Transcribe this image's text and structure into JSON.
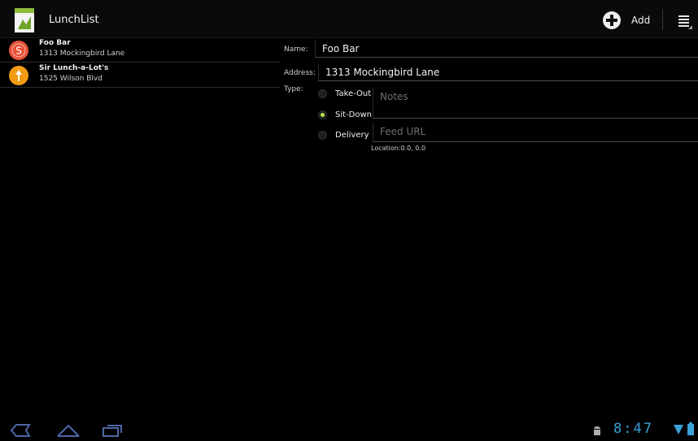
{
  "app": {
    "title": "LunchList"
  },
  "actionbar": {
    "add_label": "Add",
    "add_icon": "plus-circle-icon",
    "menu_icon": "overflow-menu-icon"
  },
  "restaurants": [
    {
      "name": "Foo Bar",
      "address": "1313 Mockingbird Lane",
      "icon": "sit-down-restaurant-icon",
      "icon_color": "#e8533b"
    },
    {
      "name": "Sir Lunch-a-Lot's",
      "address": "1525 Wilson Blvd",
      "icon": "take-out-restaurant-icon",
      "icon_color": "#f29b12"
    }
  ],
  "form": {
    "name_label": "Name:",
    "name_value": "Foo Bar",
    "address_label": "Address:",
    "address_value": "1313 Mockingbird Lane",
    "type_label": "Type:",
    "types": [
      {
        "label": "Take-Out",
        "selected": false
      },
      {
        "label": "Sit-Down",
        "selected": true
      },
      {
        "label": "Delivery",
        "selected": false
      }
    ],
    "notes_placeholder": "Notes",
    "feed_placeholder": "Feed URL",
    "location_text": "Location:0.0, 0.0"
  },
  "systembar": {
    "time": "8:47",
    "accent": "#3aa2d8"
  }
}
